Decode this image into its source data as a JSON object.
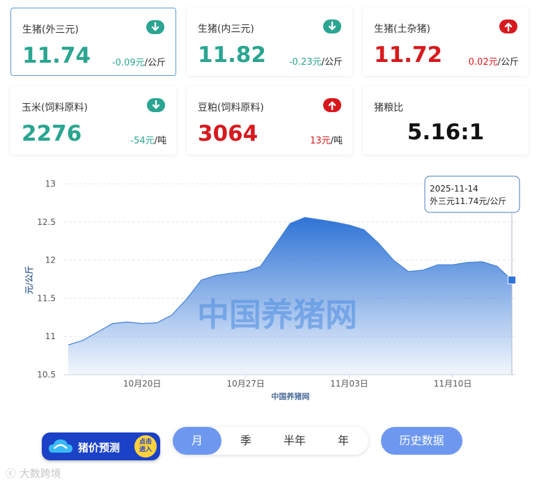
{
  "cards": [
    {
      "name": "生猪(外三元)",
      "value": "11.74",
      "change": "-0.09元",
      "unit": "/公斤",
      "dir": "down"
    },
    {
      "name": "生猪(内三元)",
      "value": "11.82",
      "change": "-0.23元",
      "unit": "/公斤",
      "dir": "down"
    },
    {
      "name": "生猪(土杂猪)",
      "value": "11.72",
      "change": "0.02元",
      "unit": "/公斤",
      "dir": "up"
    },
    {
      "name": "玉米(饲料原料)",
      "value": "2276",
      "change": "-54元",
      "unit": "/吨",
      "dir": "down"
    },
    {
      "name": "豆粕(饲料原料)",
      "value": "3064",
      "change": "13元",
      "unit": "/吨",
      "dir": "up"
    },
    {
      "name": "猪粮比",
      "value": "5.16:1"
    }
  ],
  "colors": {
    "up": "#d7191d",
    "down": "#2aa591",
    "accent": "#6e98f0",
    "line": "#3f7fd8"
  },
  "chart_data": {
    "type": "area",
    "ylabel": "元/公斤",
    "xlabel": "中国养猪网",
    "watermark": "中国养猪网",
    "ylim": [
      10.5,
      13
    ],
    "yticks": [
      "13",
      "12.5",
      "12",
      "11.5",
      "11",
      "10.5"
    ],
    "xticks": [
      "10月20日",
      "10月27日",
      "11月03日",
      "11月10日"
    ],
    "grid": true,
    "series": [
      {
        "name": "外三元",
        "x": [
          "10-15",
          "10-16",
          "10-17",
          "10-18",
          "10-19",
          "10-20",
          "10-21",
          "10-22",
          "10-23",
          "10-24",
          "10-25",
          "10-26",
          "10-27",
          "10-28",
          "10-29",
          "10-30",
          "10-31",
          "11-01",
          "11-02",
          "11-03",
          "11-04",
          "11-05",
          "11-06",
          "11-07",
          "11-08",
          "11-09",
          "11-10",
          "11-11",
          "11-12",
          "11-13",
          "11-14"
        ],
        "values": [
          10.89,
          10.95,
          11.06,
          11.17,
          11.19,
          11.17,
          11.18,
          11.28,
          11.49,
          11.74,
          11.8,
          11.83,
          11.85,
          11.92,
          12.2,
          12.48,
          12.56,
          12.53,
          12.5,
          12.46,
          12.4,
          12.22,
          12.0,
          11.85,
          11.87,
          11.94,
          11.94,
          11.97,
          11.98,
          11.92,
          11.74
        ]
      }
    ],
    "tooltip": {
      "date": "2025-11-14",
      "text": "外三元11.74元/公斤"
    }
  },
  "tabs": [
    "月",
    "季",
    "半年",
    "年"
  ],
  "active_tab": "月",
  "history_button": "历史数据",
  "predict": {
    "label": "猪价预测",
    "badge_line1": "点击",
    "badge_line2": "进入"
  },
  "watermark_bottom": "ⓒ 大数跨境"
}
